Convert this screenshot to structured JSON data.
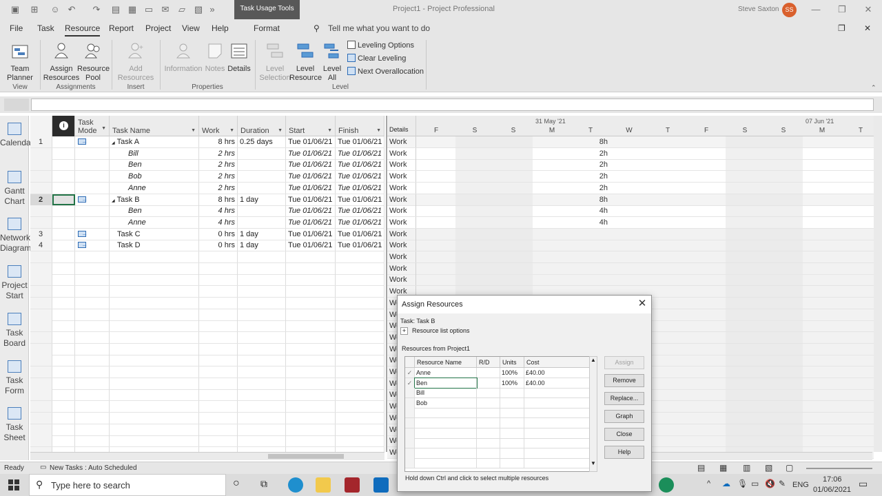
{
  "titlebar": {
    "context_tab": "Task Usage Tools",
    "doc_title": "Project1  -  Project Professional",
    "user_name": "Steve Saxton",
    "user_initials": "SS"
  },
  "menu": {
    "tabs": [
      "File",
      "Task",
      "Resource",
      "Report",
      "Project",
      "View",
      "Help",
      "Format"
    ],
    "active_tab": "Resource",
    "tell_me": "Tell me what you want to do"
  },
  "ribbon": {
    "team_planner": "Team\nPlanner",
    "assign_resources": "Assign\nResources",
    "resource_pool": "Resource\nPool",
    "add_resources": "Add\nResources",
    "information": "Information",
    "notes": "Notes",
    "details": "Details",
    "level_selection": "Level\nSelection",
    "level_resource": "Level\nResource",
    "level_all": "Level\nAll",
    "leveling_options": "Leveling Options",
    "clear_leveling": "Clear Leveling",
    "next_overallocation": "Next Overallocation",
    "groups": {
      "view": "View",
      "assignments": "Assignments",
      "insert": "Insert",
      "properties": "Properties",
      "level": "Level"
    }
  },
  "viewbar": [
    "Calendar",
    "Gantt Chart",
    "Network Diagram",
    "Project Start",
    "Task Board",
    "Task Form",
    "Task Sheet"
  ],
  "grid": {
    "headers": {
      "task_mode": "Task Mode",
      "task_name": "Task Name",
      "work": "Work",
      "duration": "Duration",
      "start": "Start",
      "finish": "Finish"
    },
    "rows": [
      {
        "num": "1",
        "name": "Task A",
        "summary": true,
        "work": "8 hrs",
        "duration": "0.25 days",
        "start": "Tue 01/06/21",
        "finish": "Tue 01/06/21"
      },
      {
        "num": "",
        "name": "Bill",
        "summary": false,
        "work": "2 hrs",
        "duration": "",
        "start": "Tue 01/06/21",
        "finish": "Tue 01/06/21"
      },
      {
        "num": "",
        "name": "Ben",
        "summary": false,
        "work": "2 hrs",
        "duration": "",
        "start": "Tue 01/06/21",
        "finish": "Tue 01/06/21"
      },
      {
        "num": "",
        "name": "Bob",
        "summary": false,
        "work": "2 hrs",
        "duration": "",
        "start": "Tue 01/06/21",
        "finish": "Tue 01/06/21"
      },
      {
        "num": "",
        "name": "Anne",
        "summary": false,
        "work": "2 hrs",
        "duration": "",
        "start": "Tue 01/06/21",
        "finish": "Tue 01/06/21"
      },
      {
        "num": "2",
        "name": "Task B",
        "summary": true,
        "work": "8 hrs",
        "duration": "1 day",
        "start": "Tue 01/06/21",
        "finish": "Tue 01/06/21"
      },
      {
        "num": "",
        "name": "Ben",
        "summary": false,
        "work": "4 hrs",
        "duration": "",
        "start": "Tue 01/06/21",
        "finish": "Tue 01/06/21"
      },
      {
        "num": "",
        "name": "Anne",
        "summary": false,
        "work": "4 hrs",
        "duration": "",
        "start": "Tue 01/06/21",
        "finish": "Tue 01/06/21"
      },
      {
        "num": "3",
        "name": "Task C",
        "summary": false,
        "task": true,
        "work": "0 hrs",
        "duration": "1 day",
        "start": "Tue 01/06/21",
        "finish": "Tue 01/06/21"
      },
      {
        "num": "4",
        "name": "Task D",
        "summary": false,
        "task": true,
        "work": "0 hrs",
        "duration": "1 day",
        "start": "Tue 01/06/21",
        "finish": "Tue 01/06/21"
      }
    ]
  },
  "timephased": {
    "details_header": "Details",
    "week1": "31 May '21",
    "week2": "07 Jun '21",
    "days": [
      "F",
      "S",
      "S",
      "M",
      "T",
      "W",
      "T",
      "F",
      "S",
      "S",
      "M",
      "T"
    ],
    "detail_label": "Work",
    "tuesday_values": [
      "8h",
      "2h",
      "2h",
      "2h",
      "2h",
      "8h",
      "4h",
      "4h"
    ]
  },
  "status": {
    "ready": "Ready",
    "new_tasks": "New Tasks : Auto Scheduled"
  },
  "taskbar": {
    "search_placeholder": "Type here to search",
    "lang": "ENG",
    "time": "17:06",
    "date": "01/06/2021"
  },
  "dialog": {
    "title": "Assign Resources",
    "task_label": "Task: Task B",
    "resource_list_options": "Resource list options",
    "resources_from": "Resources from Project1",
    "columns": [
      "Resource Name",
      "R/D",
      "Units",
      "Cost"
    ],
    "resources": [
      {
        "check": "✓",
        "name": "Anne",
        "rd": "",
        "units": "100%",
        "cost": "£40.00"
      },
      {
        "check": "✓",
        "name": "Ben",
        "rd": "",
        "units": "100%",
        "cost": "£40.00"
      },
      {
        "check": "",
        "name": "Bill",
        "rd": "",
        "units": "",
        "cost": ""
      },
      {
        "check": "",
        "name": "Bob",
        "rd": "",
        "units": "",
        "cost": ""
      }
    ],
    "buttons": {
      "assign": "Assign",
      "remove": "Remove",
      "replace": "Replace...",
      "graph": "Graph",
      "close": "Close",
      "help": "Help"
    },
    "hint": "Hold down Ctrl and click to select multiple resources"
  }
}
